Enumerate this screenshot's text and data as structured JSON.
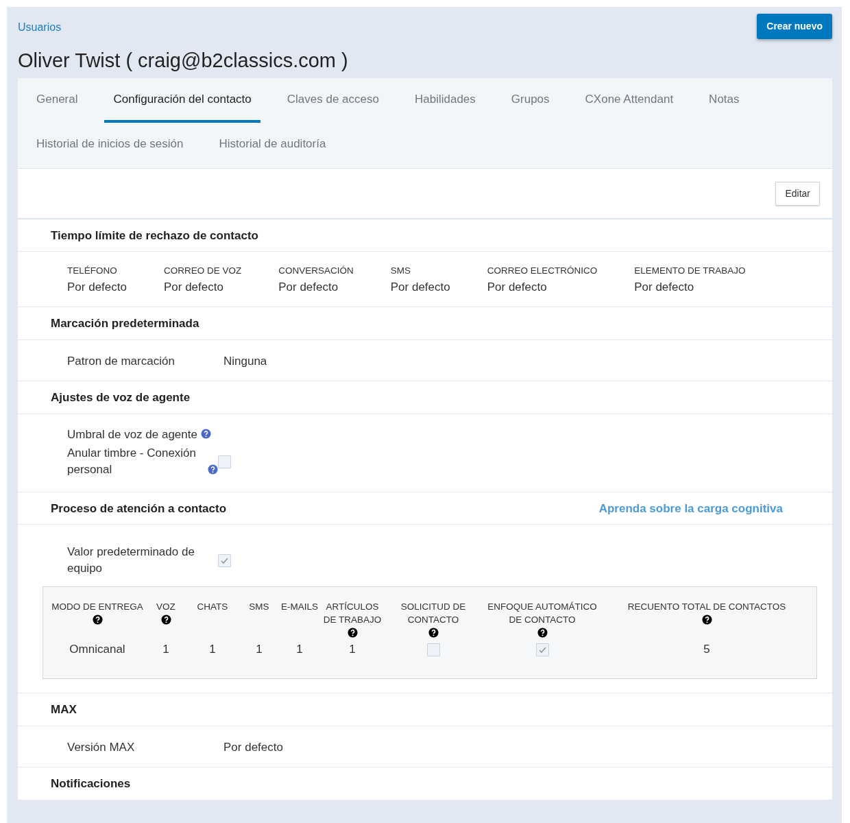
{
  "breadcrumb": "Usuarios",
  "create_button": "Crear nuevo",
  "title": "Oliver Twist ( craig@b2classics.com )",
  "tabs": [
    {
      "label": "General",
      "selected": false
    },
    {
      "label": "Configuración del contacto",
      "selected": true
    },
    {
      "label": "Claves de acceso",
      "selected": false
    },
    {
      "label": "Habilidades",
      "selected": false
    },
    {
      "label": "Grupos",
      "selected": false
    },
    {
      "label": "CXone Attendant",
      "selected": false
    },
    {
      "label": "Notas",
      "selected": false
    },
    {
      "label": "Historial de inicios de sesión",
      "selected": false
    },
    {
      "label": "Historial de auditoría",
      "selected": false
    }
  ],
  "edit_button": "Editar",
  "sections": [
    {
      "title": "Tiempo límite de rechazo de contacto",
      "kind": "columns",
      "fields": [
        {
          "label": "TELÉFONO",
          "value": "Por defecto"
        },
        {
          "label": "CORREO DE VOZ",
          "value": "Por defecto"
        },
        {
          "label": "CONVERSACIÓN",
          "value": "Por defecto"
        },
        {
          "label": "SMS",
          "value": "Por defecto"
        },
        {
          "label": "CORREO ELECTRÓNICO",
          "value": "Por defecto"
        },
        {
          "label": "ELEMENTO DE TRABAJO",
          "value": "Por defecto"
        }
      ]
    },
    {
      "title": "Marcación predeterminada",
      "kind": "pairs",
      "rows": [
        {
          "label": "Patron de marcación",
          "value": "Ninguna"
        }
      ]
    },
    {
      "title": "Ajustes de voz de agente",
      "kind": "settings",
      "rows": [
        {
          "kind": "label",
          "label": "Umbral de voz de agente",
          "help": true
        },
        {
          "kind": "checkbox",
          "label": "Anular timbre - Conexión personal",
          "help": true,
          "checked": false
        }
      ]
    },
    {
      "title": "Proceso de atención a contacto",
      "link": "Aprenda sobre la carga cognitiva",
      "kind": "settings",
      "rows": [
        {
          "kind": "checkbox",
          "label": "Valor predeterminado de equipo",
          "help": false,
          "checked": true
        }
      ],
      "table": {
        "columns": [
          {
            "label": "MODO DE ENTREGA",
            "help": true
          },
          {
            "label": "VOZ",
            "help": true
          },
          {
            "label": "CHATS",
            "help": false
          },
          {
            "label": "SMS",
            "help": false
          },
          {
            "label": "E-MAILS",
            "help": false
          },
          {
            "label": "ARTÍCULOS DE TRABAJO",
            "help": true
          },
          {
            "label": "SOLICITUD DE CONTACTO",
            "help": true
          },
          {
            "label": "ENFOQUE AUTOMÁTICO DE CONTACTO",
            "help": true
          },
          {
            "label": "RECUENTO TOTAL DE CONTACTOS",
            "help": true
          }
        ],
        "cells": [
          {
            "kind": "text",
            "text": "Omnicanal"
          },
          {
            "kind": "text",
            "text": "1"
          },
          {
            "kind": "text",
            "text": "1"
          },
          {
            "kind": "text",
            "text": "1"
          },
          {
            "kind": "text",
            "text": "1"
          },
          {
            "kind": "text",
            "text": "1"
          },
          {
            "kind": "checkbox",
            "checked": false
          },
          {
            "kind": "checkbox",
            "checked": true
          },
          {
            "kind": "text",
            "text": "5"
          }
        ]
      }
    },
    {
      "title": "MAX",
      "kind": "pairs",
      "rows": [
        {
          "label": "Versión MAX",
          "value": "Por defecto"
        }
      ]
    },
    {
      "title": "Notificaciones",
      "kind": "none"
    }
  ]
}
